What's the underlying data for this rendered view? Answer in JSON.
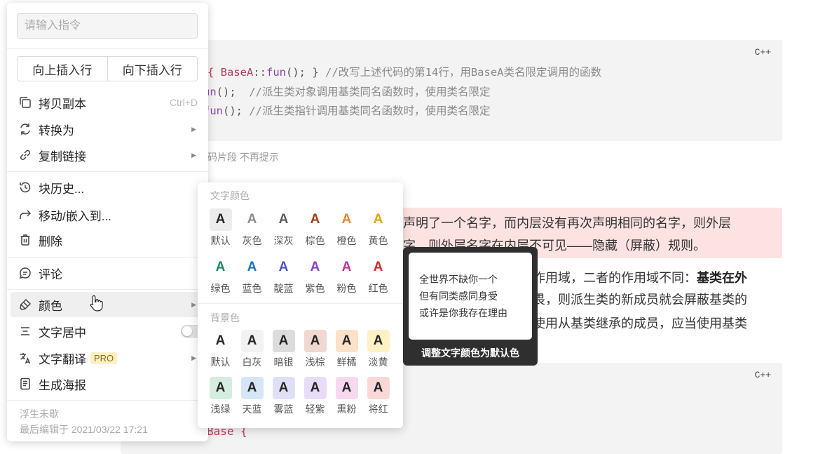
{
  "document": {
    "code_lang_label": "C++",
    "code_top": {
      "line1_brace": "{ ",
      "line1_class": "BaseA",
      "line1_sep": "::",
      "line1_fn": "fun",
      "line1_rest": "(); } ",
      "line1_comment": "//改写上述代码的第14行，用BaseA类名限定调用的函数",
      "line2_fn": "un",
      "line2_rest": "();  ",
      "line2_comment": "//派生类对象调用基类同名函数时，使用类名限定",
      "line3_fn": "fun",
      "line3_rest": "(); ",
      "line3_comment": "//派生类指针调用基类同名函数时，使用类名限定"
    },
    "hint_text": "码片段 不再提示",
    "callout_line1": "声明了一个名字，而内层没有再次声明相同的名字，则外层",
    "callout_line2": "字，则外层名字在内层不可见——隐藏（屏蔽）规则。",
    "para_line1_a": "作用域，二者的作用域不同：",
    "para_line1_b": "基类在外",
    "para_line2": "畏，则派生类的新成员就会屏蔽基类的",
    "para_line3": "使用从基类继承的成员，应当使用基类",
    "code_bottom_text": "Base {"
  },
  "context_menu": {
    "command_placeholder": "请输入指令",
    "insert_above": "向上插入行",
    "insert_below": "向下插入行",
    "items": [
      {
        "label": "拷贝副本",
        "shortcut": "Ctrl+D",
        "icon": "copy-icon"
      },
      {
        "label": "转换为",
        "icon": "convert-icon",
        "submenu": true
      },
      {
        "label": "复制链接",
        "icon": "link-icon",
        "submenu": true
      },
      {
        "label": "块历史...",
        "icon": "history-icon"
      },
      {
        "label": "移动/嵌入到...",
        "icon": "move-icon"
      },
      {
        "label": "删除",
        "icon": "trash-icon"
      },
      {
        "label": "评论",
        "icon": "comment-icon"
      },
      {
        "label": "颜色",
        "icon": "color-brush-icon",
        "submenu": true,
        "active": true
      },
      {
        "label": "文字居中",
        "icon": "align-center-icon",
        "toggle": false
      },
      {
        "label": "文字翻译",
        "icon": "translate-icon",
        "badge": "PRO",
        "submenu": true
      },
      {
        "label": "生成海报",
        "icon": "poster-icon"
      }
    ],
    "submenu_arrow": "▶",
    "footer_author": "浮生未歇",
    "footer_edited": "最后编辑于 2021/03/22 17:21"
  },
  "color_panel": {
    "text_heading": "文字颜色",
    "bg_heading": "背景色",
    "glyph": "A",
    "text_colors": [
      {
        "label": "默认",
        "color": "#262626",
        "selected": true
      },
      {
        "label": "灰色",
        "color": "#8c8c8c"
      },
      {
        "label": "深灰",
        "color": "#595959"
      },
      {
        "label": "棕色",
        "color": "#a0401f"
      },
      {
        "label": "橙色",
        "color": "#f0812d"
      },
      {
        "label": "黄色",
        "color": "#e1a800"
      },
      {
        "label": "绿色",
        "color": "#1b8a5f"
      },
      {
        "label": "蓝色",
        "color": "#1a73c9"
      },
      {
        "label": "靛蓝",
        "color": "#4b52c4"
      },
      {
        "label": "紫色",
        "color": "#8a3fc7"
      },
      {
        "label": "粉色",
        "color": "#c8329a"
      },
      {
        "label": "红色",
        "color": "#d9262f"
      }
    ],
    "bg_colors": [
      {
        "label": "默认",
        "color": "#ffffff"
      },
      {
        "label": "白灰",
        "color": "#f2f2f2"
      },
      {
        "label": "暗银",
        "color": "#dcdcdc"
      },
      {
        "label": "浅棕",
        "color": "#f0d9d0"
      },
      {
        "label": "鲜橘",
        "color": "#fde0c8"
      },
      {
        "label": "淡黄",
        "color": "#fdf2c5"
      },
      {
        "label": "浅绿",
        "color": "#d4eddf"
      },
      {
        "label": "天蓝",
        "color": "#d5e6f7"
      },
      {
        "label": "雾蓝",
        "color": "#dfe0f6"
      },
      {
        "label": "轻紫",
        "color": "#e9dcf7"
      },
      {
        "label": "熏粉",
        "color": "#f6d9ef"
      },
      {
        "label": "将红",
        "color": "#fbd8d8"
      }
    ]
  },
  "tooltip": {
    "line1": "全世界不缺你一个",
    "line2": "但有同类感同身受",
    "line3": "或许是你我存在理由",
    "caption": "调整文字颜色为默认色"
  }
}
